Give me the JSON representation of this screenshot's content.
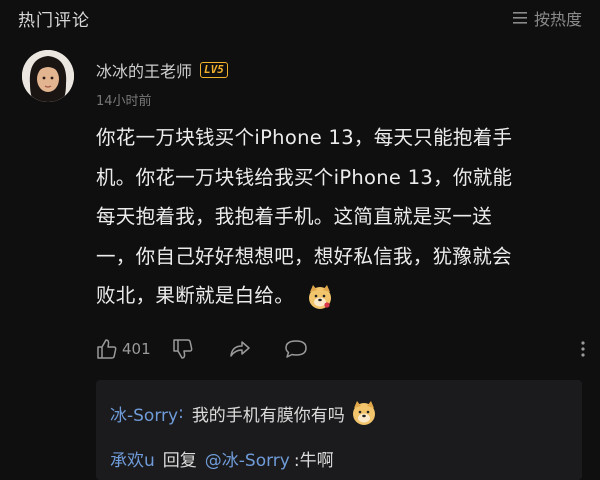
{
  "header": {
    "title": "热门评论",
    "sort_label": "按热度"
  },
  "comment": {
    "username": "冰冰的王老师",
    "level_badge": "LV5",
    "timestamp": "14小时前",
    "lines": [
      "你花一万块钱买个iPhone 13，每天只能抱着手",
      "机。你花一万块钱给我买个iPhone 13，你就能",
      "每天抱着我，我抱着手机。这简直就是买一送",
      "一，你自己好好想想吧，想好私信我，犹豫就会",
      "败北，果断就是白给。"
    ],
    "like_count": "401"
  },
  "replies": [
    {
      "author": "冰-Sorry",
      "colon": ":",
      "text": "我的手机有膜你有吗"
    },
    {
      "author": "承欢u",
      "action": "回复",
      "mention": "@冰-Sorry",
      "text": ":牛啊"
    }
  ],
  "colors": {
    "background": "#0f0f10",
    "accent_blue": "#6f9bd8",
    "badge_gold": "#f0b02c"
  }
}
